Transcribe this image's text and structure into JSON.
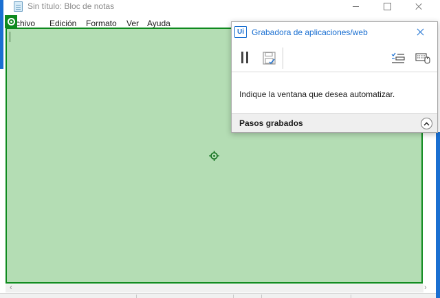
{
  "notepad": {
    "title": "Sin título: Bloc de notas",
    "menu": [
      "rchivo",
      "Edición",
      "Formato",
      "Ver",
      "Ayuda"
    ]
  },
  "recorder": {
    "title": "Grabadora de aplicaciones/web",
    "logo_text": "Ui",
    "message": "Indique la ventana que desea automatizar.",
    "steps_label": "Pasos grabados"
  },
  "colors": {
    "selection_fill": "#70be70",
    "selection_border": "#0e8a1e",
    "recorder_accent": "#1a6fd1"
  },
  "icons": {
    "pause": "pause-icon",
    "save": "save-icon",
    "steps": "steps-list-icon",
    "keyboard": "keyboard-mouse-icon",
    "collapse": "chevron-up-icon",
    "target": "crosshair-icon"
  }
}
